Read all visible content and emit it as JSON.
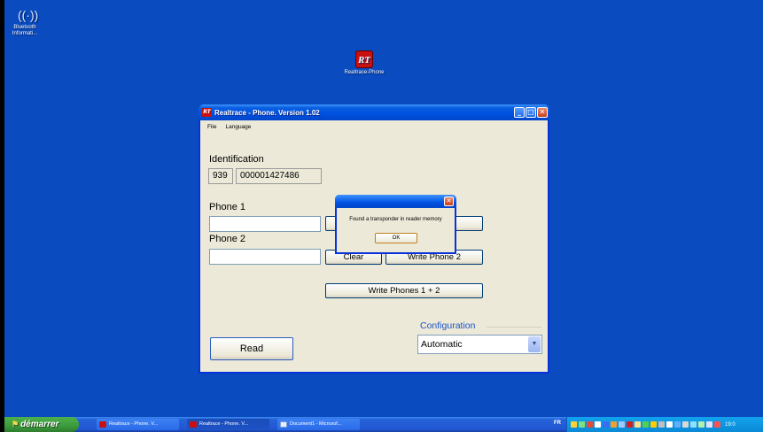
{
  "desktop": {
    "icons": [
      {
        "label": "Bluetooth Informati...",
        "icon": "bluetooth-icon"
      },
      {
        "label": "Realtrace-Phone",
        "icon": "realtrace-icon"
      }
    ]
  },
  "window": {
    "title": "Realtrace - Phone. Version 1.02",
    "app_icon_text": "RT",
    "menu": [
      "File",
      "Language"
    ],
    "identification": {
      "label": "Identification",
      "code": "939",
      "number": "000001427486"
    },
    "phone1": {
      "label": "Phone 1",
      "value": "",
      "write_label": "Write Phone 1"
    },
    "phone2": {
      "label": "Phone 2",
      "value": "",
      "clear_label": "Clear",
      "write_label": "Write Phone 2"
    },
    "write_both_label": "Write Phones 1 + 2",
    "read_label": "Read",
    "configuration": {
      "label": "Configuration",
      "selected": "Automatic"
    }
  },
  "dialog": {
    "message": "Found a transponder in reader memory",
    "ok_label": "OK"
  },
  "taskbar": {
    "start_label": "démarrer",
    "tasks": [
      {
        "label": "Realtrace - Phone. V...",
        "icon": "realtrace-icon",
        "active": false
      },
      {
        "label": "Realtrace - Phone. V...",
        "icon": "realtrace-icon",
        "active": true
      },
      {
        "label": "Document1 - Microsof...",
        "icon": "word-icon",
        "active": false
      }
    ],
    "language": "FR",
    "clock": "19:0"
  },
  "colors": {
    "desktop": "#0a4bbf",
    "titlebar": "#0050e0",
    "start": "#3c9a3c",
    "window_bg": "#ece9d8"
  }
}
